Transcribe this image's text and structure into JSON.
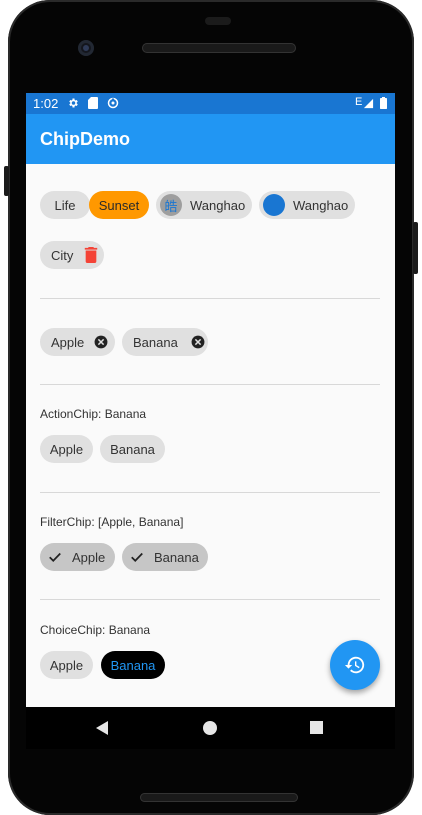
{
  "status_bar": {
    "time": "1:02",
    "left_icons": [
      "gear-icon",
      "sd-card-icon",
      "data-saver-icon"
    ],
    "network_label": "E",
    "right_icons": [
      "signal-icon",
      "battery-icon"
    ]
  },
  "app_bar": {
    "title": "ChipDemo"
  },
  "section_chips": {
    "chips": [
      {
        "label": "Life"
      },
      {
        "label": "Sunset",
        "color": "#ff9800"
      },
      {
        "label": "Wanghao",
        "avatar_text": "皓"
      },
      {
        "label": "Wanghao",
        "avatar_color": "#1976d2"
      },
      {
        "label": "City",
        "trailing_icon": "delete-icon",
        "trailing_color": "#f44336"
      }
    ]
  },
  "section_input": {
    "chips": [
      {
        "label": "Apple",
        "trailing_icon": "cancel-icon"
      },
      {
        "label": "Banana",
        "trailing_icon": "cancel-icon"
      }
    ]
  },
  "section_action": {
    "caption": "ActionChip: Banana",
    "chips": [
      {
        "label": "Apple"
      },
      {
        "label": "Banana"
      }
    ]
  },
  "section_filter": {
    "caption": "FilterChip: [Apple, Banana]",
    "chips": [
      {
        "label": "Apple",
        "selected": true
      },
      {
        "label": "Banana",
        "selected": true
      }
    ]
  },
  "section_choice": {
    "caption": "ChoiceChip: Banana",
    "chips": [
      {
        "label": "Apple",
        "selected": false
      },
      {
        "label": "Banana",
        "selected": true,
        "selected_bg": "#000000",
        "selected_text": "#2196f3"
      }
    ]
  },
  "fab": {
    "icon": "history-icon"
  },
  "nav_bar": {
    "icons": [
      "back-icon",
      "home-icon",
      "recents-icon"
    ]
  }
}
